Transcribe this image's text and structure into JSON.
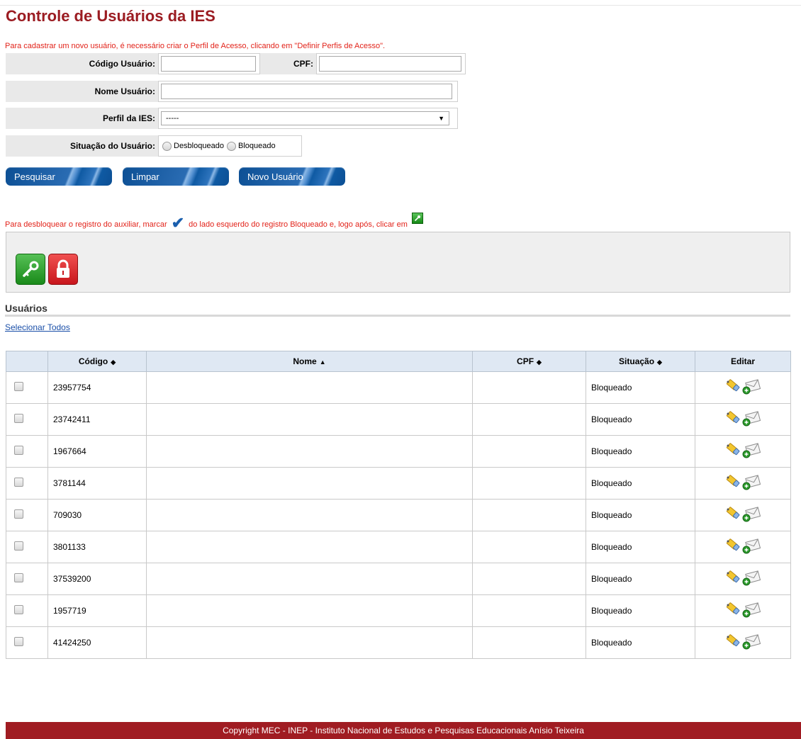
{
  "page": {
    "title": "Controle de Usuários da IES",
    "notice": "Para cadastrar um novo usuário, é necessário criar o Perfil de Acesso, clicando em \"Definir Perfis de Acesso\"."
  },
  "filters": {
    "codigo_label": "Código Usuário:",
    "codigo_value": "",
    "cpf_label": "CPF:",
    "cpf_value": "",
    "nome_label": "Nome Usuário:",
    "nome_value": "",
    "perfil_label": "Perfil da IES:",
    "perfil_selected": "-----",
    "situacao_label": "Situação do Usuário:",
    "situacao_options": [
      "Desbloqueado",
      "Bloqueado"
    ]
  },
  "buttons": {
    "pesquisar": "Pesquisar",
    "limpar": "Limpar",
    "novo_usuario": "Novo Usuário"
  },
  "unlock_notice": {
    "part1": "Para desbloquear o registro do auxiliar, marcar",
    "part2": "do lado esquerdo do registro Bloqueado e, logo após, clicar em"
  },
  "icons": [
    "check-icon",
    "key-icon",
    "lock-icon",
    "edit-pencil-icon",
    "email-icon"
  ],
  "section": {
    "title": "Usuários",
    "select_all": "Selecionar Todos"
  },
  "table": {
    "headers": {
      "codigo": "Código",
      "nome": "Nome",
      "cpf": "CPF",
      "situacao": "Situação",
      "editar": "Editar"
    },
    "rows": [
      {
        "codigo": "23957754",
        "nome": "",
        "cpf": "",
        "situacao": "Bloqueado"
      },
      {
        "codigo": "23742411",
        "nome": "",
        "cpf": "",
        "situacao": "Bloqueado"
      },
      {
        "codigo": "1967664",
        "nome": "",
        "cpf": "",
        "situacao": "Bloqueado"
      },
      {
        "codigo": "3781144",
        "nome": "",
        "cpf": "",
        "situacao": "Bloqueado"
      },
      {
        "codigo": "709030",
        "nome": "",
        "cpf": "",
        "situacao": "Bloqueado"
      },
      {
        "codigo": "3801133",
        "nome": "",
        "cpf": "",
        "situacao": "Bloqueado"
      },
      {
        "codigo": "37539200",
        "nome": "",
        "cpf": "",
        "situacao": "Bloqueado"
      },
      {
        "codigo": "1957719",
        "nome": "",
        "cpf": "",
        "situacao": "Bloqueado"
      },
      {
        "codigo": "41424250",
        "nome": "",
        "cpf": "",
        "situacao": "Bloqueado"
      }
    ]
  },
  "colors": {
    "title": "#9b1c22",
    "notice": "#e2231a",
    "button": "#0c4f94",
    "header_bg": "#dfe8f3",
    "footer_bg": "#a01c22"
  },
  "footer": {
    "text": "Copyright MEC - INEP - Instituto Nacional de Estudos e Pesquisas Educacionais Anísio Teixeira"
  }
}
